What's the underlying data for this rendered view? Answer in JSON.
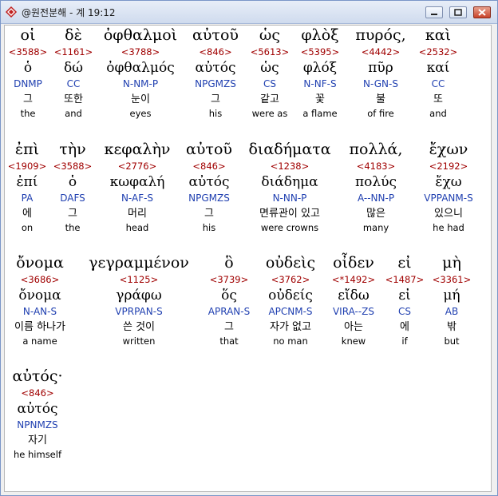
{
  "window": {
    "title": "@원전분해 - 계 19:12"
  },
  "rows": [
    [
      {
        "greek": "οἱ",
        "num": "<3588>",
        "lemma": "ὁ",
        "parse": "DNMP",
        "kor": "그",
        "eng": "the"
      },
      {
        "greek": "δὲ",
        "num": "<1161>",
        "lemma": "δώ",
        "parse": "CC",
        "kor": "또한",
        "eng": "and"
      },
      {
        "greek": "ὀφθαλμοὶ",
        "num": "<3788>",
        "lemma": "ὀφθαλμός",
        "parse": "N-NM-P",
        "kor": "눈이",
        "eng": "eyes"
      },
      {
        "greek": "αὐτοῦ",
        "num": "<846>",
        "lemma": "αὐτός",
        "parse": "NPGMZS",
        "kor": "그",
        "eng": "his"
      },
      {
        "greek": "ὡς",
        "num": "<5613>",
        "lemma": "ὡς",
        "parse": "CS",
        "kor": "같고",
        "eng": "were as"
      },
      {
        "greek": "φλὸξ",
        "num": "<5395>",
        "lemma": "φλόξ",
        "parse": "N-NF-S",
        "kor": "꽃",
        "eng": "a flame"
      },
      {
        "greek": "πυρός,",
        "num": "<4442>",
        "lemma": "πῦρ",
        "parse": "N-GN-S",
        "kor": "불",
        "eng": "of fire"
      },
      {
        "greek": "καὶ",
        "num": "<2532>",
        "lemma": "καί",
        "parse": "CC",
        "kor": "또",
        "eng": "and"
      }
    ],
    [
      {
        "greek": "ἐπὶ",
        "num": "<1909>",
        "lemma": "ἐπί",
        "parse": "PA",
        "kor": "에",
        "eng": "on"
      },
      {
        "greek": "τὴν",
        "num": "<3588>",
        "lemma": "ὁ",
        "parse": "DAFS",
        "kor": "그",
        "eng": "the"
      },
      {
        "greek": "κεφαλὴν",
        "num": "<2776>",
        "lemma": "κωφαλή",
        "parse": "N-AF-S",
        "kor": "머리",
        "eng": "head"
      },
      {
        "greek": "αὐτοῦ",
        "num": "<846>",
        "lemma": "αὐτός",
        "parse": "NPGMZS",
        "kor": "그",
        "eng": "his"
      },
      {
        "greek": "διαδήματα",
        "num": "<1238>",
        "lemma": "διάδημα",
        "parse": "N-NN-P",
        "kor": "면류관이 있고",
        "eng": "were crowns"
      },
      {
        "greek": "πολλά,",
        "num": "<4183>",
        "lemma": "πολύς",
        "parse": "A--NN-P",
        "kor": "많은",
        "eng": "many"
      },
      {
        "greek": "ἔχων",
        "num": "<2192>",
        "lemma": "ἔχω",
        "parse": "VPPANM-S",
        "kor": "있으니",
        "eng": "he had"
      }
    ],
    [
      {
        "greek": "ὄνομα",
        "num": "<3686>",
        "lemma": "ὄνομα",
        "parse": "N-AN-S",
        "kor": "이름 하나가",
        "eng": "a name"
      },
      {
        "greek": "γεγραμμένον",
        "num": "<1125>",
        "lemma": "γράφω",
        "parse": "VPRPAN-S",
        "kor": "쓴 것이",
        "eng": "written"
      },
      {
        "greek": "ὃ",
        "num": "<3739>",
        "lemma": "ὅς",
        "parse": "APRAN-S",
        "kor": "그",
        "eng": "that"
      },
      {
        "greek": "οὐδεὶς",
        "num": "<3762>",
        "lemma": "οὐδείς",
        "parse": "APCNM-S",
        "kor": "자가 없고",
        "eng": "no man"
      },
      {
        "greek": "οἶδεν",
        "num": "<*1492>",
        "lemma": "εἴδω",
        "parse": "VIRA--ZS",
        "kor": "아는",
        "eng": "knew"
      },
      {
        "greek": "εἰ",
        "num": "<1487>",
        "lemma": "εἰ",
        "parse": "CS",
        "kor": "에",
        "eng": "if"
      },
      {
        "greek": "μὴ",
        "num": "<3361>",
        "lemma": "μή",
        "parse": "AB",
        "kor": "밖",
        "eng": "but"
      }
    ],
    [
      {
        "greek": "αὐτός·",
        "num": "<846>",
        "lemma": "αὐτός",
        "parse": "NPNMZS",
        "kor": "자기",
        "eng": "he himself"
      }
    ]
  ]
}
